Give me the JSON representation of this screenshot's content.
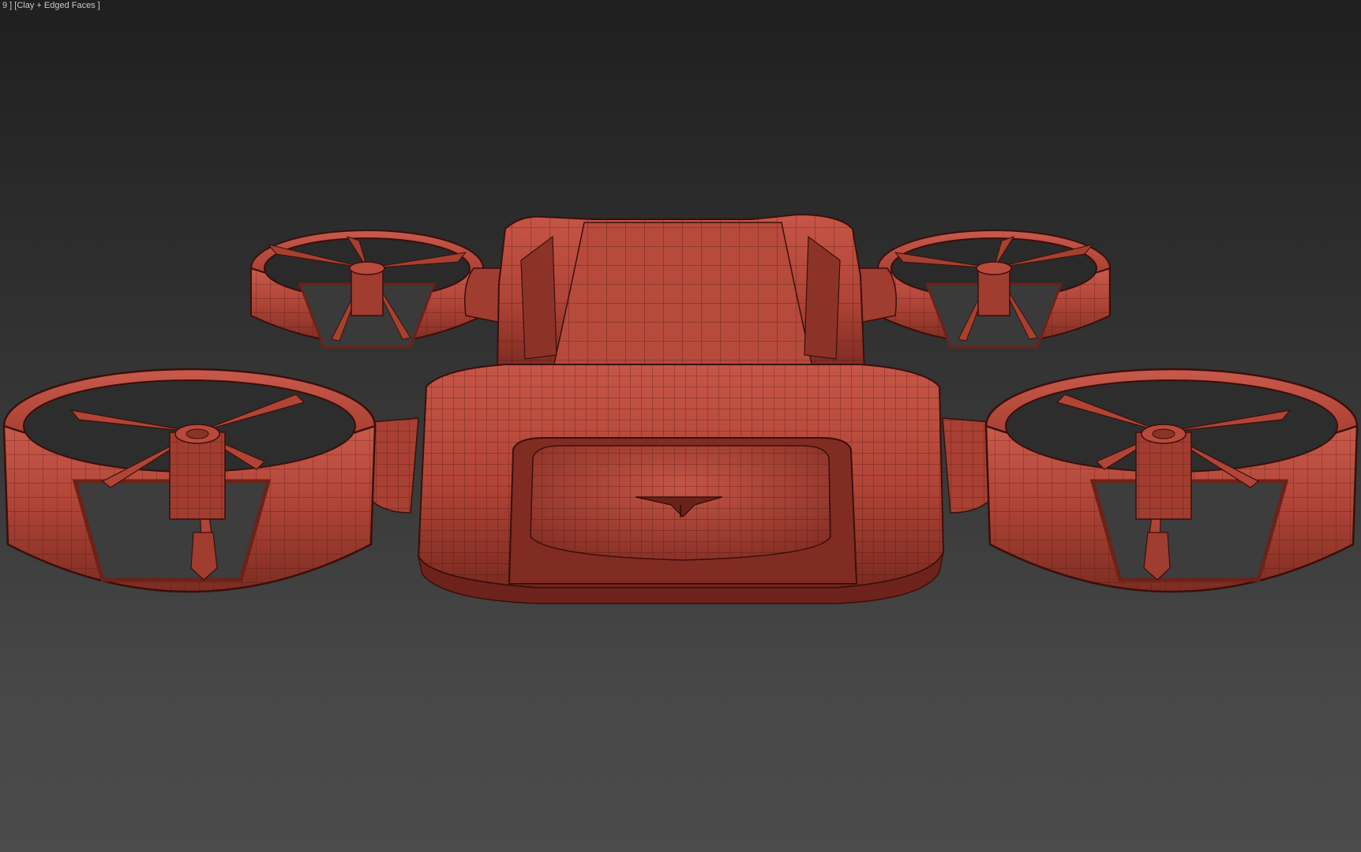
{
  "viewport": {
    "label_prefix": "9 ]",
    "shading_mode": "[Clay + Edged Faces ]"
  },
  "colors": {
    "background_top": "#1f1f1f",
    "background_bottom": "#4b4b4b",
    "clay": "#b04436",
    "clay_dark": "#7a2a21",
    "clay_light": "#c65647",
    "edge": "#3a0f0b"
  },
  "scene": {
    "object": "drone-vehicle",
    "shading": "clay",
    "show_edges": true,
    "rotor_count": 4
  }
}
